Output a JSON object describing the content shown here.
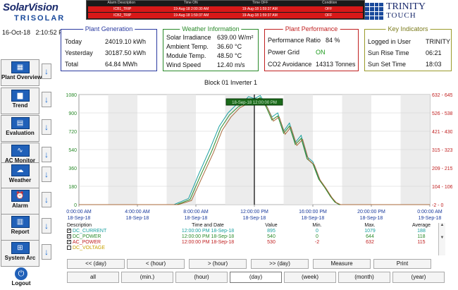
{
  "header": {
    "logo_main": "SolarVision",
    "logo_sub": "TRISOLAR",
    "brand_line1": "TRINITY",
    "brand_line2": "TOUCH",
    "date": "16-Oct-18",
    "time": "2:10:52 PM"
  },
  "alarms": {
    "headers": [
      "Alarm Description",
      "Time ON",
      "Time OFF",
      "Condition"
    ],
    "rows": [
      {
        "desc": "ICB1_TRIP",
        "on": "19-Aug-18 2:00:30 AM",
        "off": "19-Aug-18 1:59:37 AM",
        "cond": "OFF"
      },
      {
        "desc": "ICB2_TRIP",
        "on": "19-Aug-18 1:59:37 AM",
        "off": "19-Aug-18 1:59:37 AM",
        "cond": "OFF"
      }
    ]
  },
  "plant_generation": {
    "title": "Plant Generation",
    "rows": [
      {
        "label": "Today",
        "value": "24019.10 kWh"
      },
      {
        "label": "Yesterday",
        "value": "30187.50 kWh"
      },
      {
        "label": "Total",
        "value": "64.84 MWh"
      }
    ]
  },
  "weather": {
    "title": "Weather Information",
    "rows": [
      {
        "label": "Solar Irradiance",
        "value": "639.00 W/m²"
      },
      {
        "label": "Ambient Temp.",
        "value": "36.60 °C"
      },
      {
        "label": "Module Temp.",
        "value": "48.50 °C"
      },
      {
        "label": "Wind Speed",
        "value": "12.40 m/s"
      }
    ]
  },
  "performance": {
    "title": "Plant Performance",
    "rows": [
      {
        "label": "Performance Ratio",
        "value": "84 %"
      },
      {
        "label": "Power Grid",
        "value": "ON"
      },
      {
        "label": "CO2 Avoidance",
        "value": "14313 Tonnes"
      }
    ]
  },
  "key_indicators": {
    "title": "Key Indicators",
    "rows": [
      {
        "label": "Logged in User",
        "value": "TRINITY"
      },
      {
        "label": "Sun Rise Time",
        "value": "06:21"
      },
      {
        "label": "Sun Set Time",
        "value": "18:03"
      }
    ]
  },
  "sidebar": {
    "items": [
      {
        "label": "Plant Overview",
        "icon": "plant-icon",
        "glyph": "▦"
      },
      {
        "label": "Trend",
        "icon": "trend-icon",
        "glyph": "▆"
      },
      {
        "label": "Evaluation",
        "icon": "evaluation-icon",
        "glyph": "▤"
      },
      {
        "label": "AC Monitor",
        "icon": "ac-monitor-icon",
        "glyph": "∿"
      },
      {
        "label": "Weather",
        "icon": "weather-icon",
        "glyph": "☁"
      },
      {
        "label": "Alarm",
        "icon": "alarm-icon",
        "glyph": "⏰"
      },
      {
        "label": "Report",
        "icon": "report-icon",
        "glyph": "▥"
      },
      {
        "label": "System Arc",
        "icon": "system-arc-icon",
        "glyph": "⊞"
      }
    ],
    "arrow_glyph": "↓",
    "logout_label": "Logout",
    "logout_glyph": "⏻"
  },
  "chart_title": "Block 01 Inverter 1",
  "chart_tooltip": "18-Sep-18 12:00:00 PM",
  "chart_data": {
    "type": "line",
    "title": "Block 01 Inverter 1",
    "x_ticks": [
      {
        "time": "0:00:00 AM",
        "date": "18-Sep-18",
        "hour": 0
      },
      {
        "time": "4:00:00 AM",
        "date": "18-Sep-18",
        "hour": 4
      },
      {
        "time": "8:00:00 AM",
        "date": "18-Sep-18",
        "hour": 8
      },
      {
        "time": "12:00:00 PM",
        "date": "18-Sep-18",
        "hour": 12
      },
      {
        "time": "16:00:00 PM",
        "date": "18-Sep-18",
        "hour": 16
      },
      {
        "time": "20:00:00 PM",
        "date": "18-Sep-18",
        "hour": 20
      },
      {
        "time": "0:00:00 AM",
        "date": "19-Sep-18",
        "hour": 24
      }
    ],
    "xlim": [
      0,
      24
    ],
    "left_axis": {
      "ticks": [
        0,
        180,
        360,
        540,
        720,
        900,
        1080
      ],
      "ylim": [
        0,
        1080
      ],
      "color": "#2a8a2a"
    },
    "right_axis": {
      "tick_labels": [
        "-2 - 0",
        "104 - 106",
        "209 - 215",
        "315 - 323",
        "421 - 430",
        "526 - 538",
        "632 - 645"
      ],
      "color": "#c02020"
    },
    "cursor_hour": 12,
    "series": [
      {
        "name": "DC_CURRENT",
        "color": "#18a0a0",
        "x": [
          0,
          6.5,
          7.5,
          8.2,
          9,
          9.6,
          10.2,
          10.8,
          11.2,
          11.6,
          12,
          12.4,
          12.8,
          13.2,
          13.6,
          14,
          14.4,
          14.8,
          15.2,
          15.6,
          16,
          16.4,
          16.8,
          17.2,
          17.5,
          17.8,
          24
        ],
        "y": [
          0,
          0,
          60,
          300,
          560,
          770,
          900,
          985,
          1000,
          1060,
          1040,
          1070,
          980,
          860,
          900,
          720,
          800,
          610,
          680,
          470,
          420,
          260,
          180,
          90,
          30,
          0,
          0
        ]
      },
      {
        "name": "DC_POWER",
        "color": "#2a8a2a",
        "x": [
          0,
          6.7,
          7.6,
          8.3,
          9.1,
          9.7,
          10.3,
          10.9,
          11.3,
          11.7,
          12,
          12.4,
          12.8,
          13.2,
          13.6,
          14,
          14.4,
          14.8,
          15.2,
          15.6,
          16,
          16.4,
          16.8,
          17.2,
          17.5,
          17.8,
          24
        ],
        "y": [
          0,
          0,
          50,
          280,
          530,
          750,
          880,
          960,
          990,
          1040,
          1020,
          1050,
          960,
          830,
          870,
          700,
          770,
          590,
          650,
          450,
          400,
          250,
          170,
          80,
          25,
          0,
          0
        ]
      },
      {
        "name": "AC_POWER",
        "color": "#a86a3a",
        "x": [
          0,
          6.8,
          7.7,
          8.4,
          9.2,
          9.8,
          10.4,
          11,
          11.4,
          11.8,
          12.1,
          12.5,
          12.9,
          13.3,
          13.7,
          14.1,
          14.5,
          14.9,
          15.3,
          15.7,
          16.1,
          16.5,
          16.9,
          17.3,
          17.6,
          17.9,
          24
        ],
        "y": [
          0,
          0,
          40,
          260,
          510,
          730,
          860,
          950,
          980,
          1030,
          1010,
          1040,
          950,
          820,
          860,
          690,
          760,
          580,
          640,
          440,
          390,
          240,
          160,
          70,
          20,
          0,
          0
        ]
      }
    ]
  },
  "legend": {
    "headers": [
      "Description",
      "Time and Date",
      "Value",
      "Min.",
      "Max.",
      "Average"
    ],
    "rows": [
      {
        "name": "DC_CURRENT",
        "time": "12:00:00 PM 18-Sep-18",
        "value": "895",
        "min": "0",
        "max": "1079",
        "avg": "188",
        "color": "#18a0a0",
        "checked": true
      },
      {
        "name": "DC_POWER",
        "time": "12:00:00 PM 18-Sep-18",
        "value": "540",
        "min": "0",
        "max": "644",
        "avg": "118",
        "color": "#2a8a2a",
        "checked": true
      },
      {
        "name": "AC_POWER",
        "time": "12:00:00 PM 18-Sep-18",
        "value": "530",
        "min": "-2",
        "max": "632",
        "avg": "115",
        "color": "#c02020",
        "checked": true
      },
      {
        "name": "DC_VOLTAGE",
        "time": "",
        "value": "",
        "min": "",
        "max": "",
        "avg": "",
        "color": "#c8a000",
        "checked": false
      }
    ],
    "check_glyph": "✓"
  },
  "nav_buttons": [
    "<< (day)",
    "< (hour)",
    "> (hour)",
    ">> (day)",
    "Measure",
    "Print"
  ],
  "range_buttons": [
    "all",
    "(min.)",
    "(hour)",
    "(day)",
    "(week)",
    "(month)",
    "(year)"
  ],
  "selected_range": "(day)"
}
